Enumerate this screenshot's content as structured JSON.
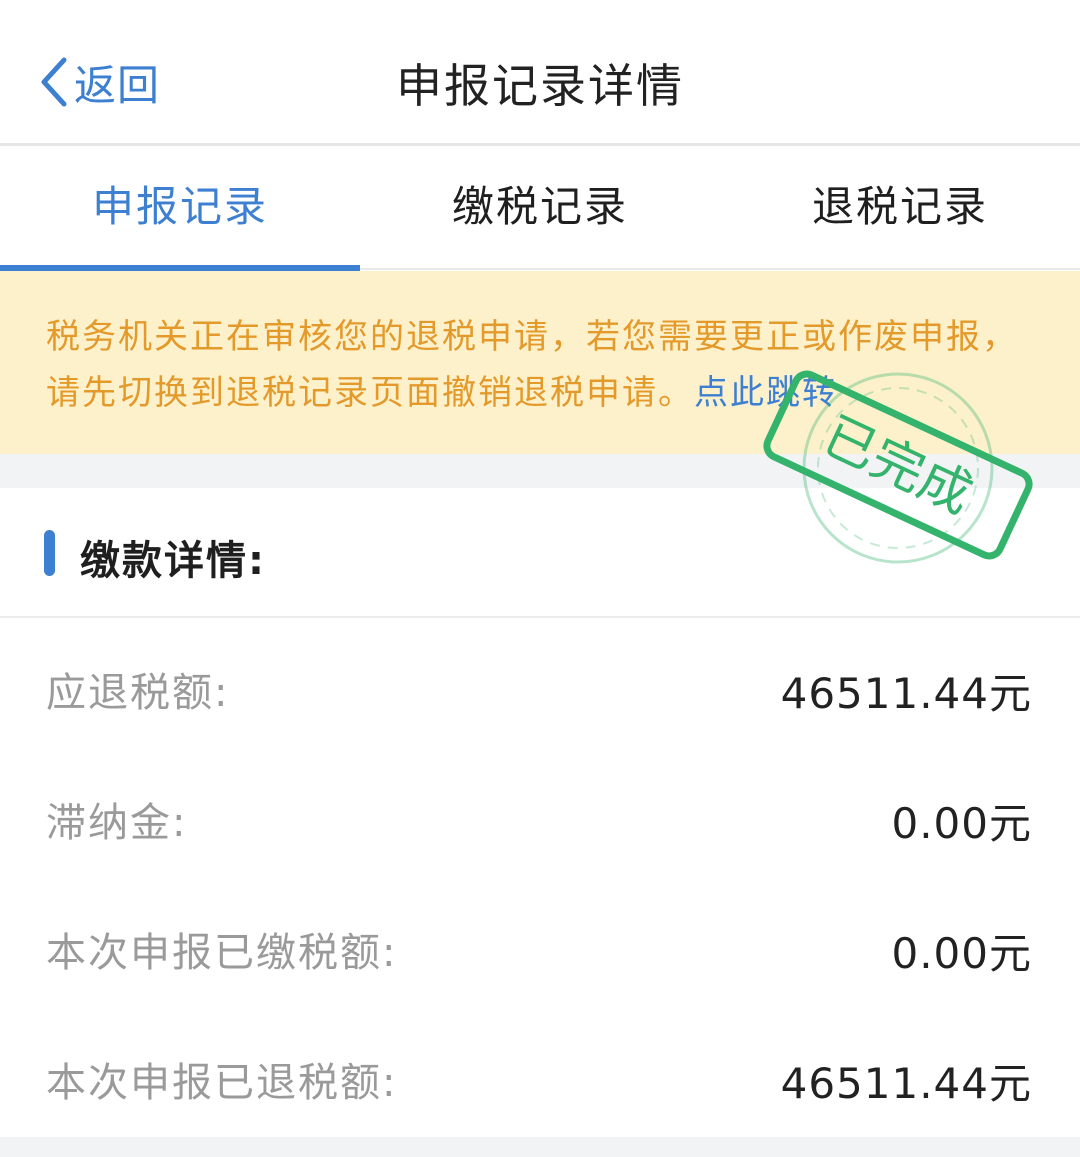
{
  "navbar": {
    "back_label": "返回",
    "title": "申报记录详情"
  },
  "tabs": [
    {
      "label": "申报记录",
      "active": true
    },
    {
      "label": "缴税记录",
      "active": false
    },
    {
      "label": "退税记录",
      "active": false
    }
  ],
  "notice": {
    "text": "税务机关正在审核您的退税申请，若您需要更正或作废申报，请先切换到退税记录页面撤销退税申请。",
    "link": "点此跳转"
  },
  "stamp": {
    "text": "已完成"
  },
  "section": {
    "title": "缴款详情:"
  },
  "rows": [
    {
      "label": "应退税额:",
      "value": "46511.44元"
    },
    {
      "label": "滞纳金:",
      "value": "0.00元"
    },
    {
      "label": "本次申报已缴税额:",
      "value": "0.00元"
    },
    {
      "label": "本次申报已退税额:",
      "value": "46511.44元"
    }
  ],
  "colors": {
    "accent": "#3d7fd0",
    "notice_bg": "#fdf1cc",
    "notice_text": "#e39a2a",
    "stamp": "#33b36b"
  },
  "icons": {
    "back": "chevron-left-icon"
  }
}
